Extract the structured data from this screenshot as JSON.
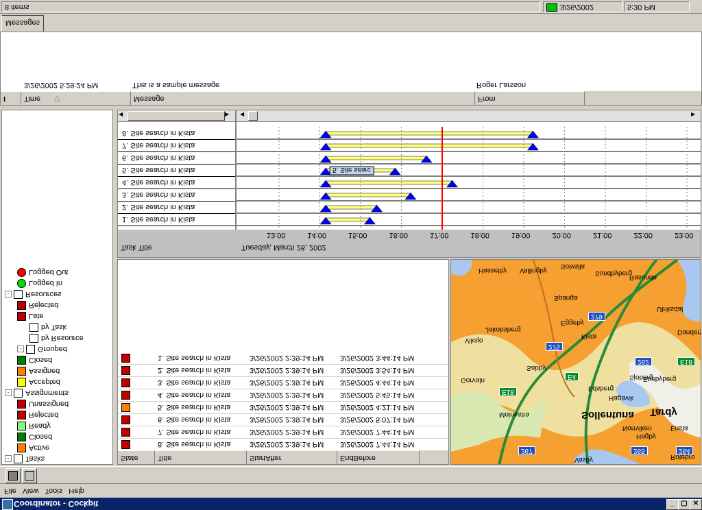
{
  "window": {
    "title": "Coordinator - Cockpit",
    "buttons": [
      "_",
      "▢",
      "✕"
    ]
  },
  "menu": [
    "File",
    "View",
    "Tools",
    "Help"
  ],
  "status": {
    "items_count": "8 items",
    "date": "3/26/2002",
    "time": "5:30 PM",
    "indicator_color": "#00c000"
  },
  "tabs": [
    "Messages"
  ],
  "messages": {
    "headers": [
      "Time",
      "Message",
      "From"
    ],
    "rows": [
      {
        "time": "3/26/2002 5:29:24 PM",
        "message": "This is a sample message",
        "from": "Roger Larsson"
      }
    ]
  },
  "tree": {
    "nodes": [
      {
        "label": "Tasks",
        "level": 0,
        "expand": "-",
        "icon": "tasks-icon",
        "color": "#ffffff"
      },
      {
        "label": "Active",
        "level": 1,
        "expand": "",
        "icon": "state-icon",
        "color": "#ff8000"
      },
      {
        "label": "Closed",
        "level": 1,
        "expand": "",
        "icon": "check-icon",
        "color": "#008000"
      },
      {
        "label": "Ready",
        "level": 1,
        "expand": "",
        "icon": "state-icon",
        "color": "#80ff80"
      },
      {
        "label": "Rejected",
        "level": 1,
        "expand": "",
        "icon": "reject-icon",
        "color": "#c00000"
      },
      {
        "label": "Unassigned",
        "level": 1,
        "expand": "",
        "icon": "state-icon",
        "color": "#c00000"
      },
      {
        "label": "Assignments",
        "level": 0,
        "expand": "-",
        "icon": "assignments-icon",
        "color": "#ffffff"
      },
      {
        "label": "Accepted",
        "level": 1,
        "expand": "",
        "icon": "state-icon",
        "color": "#ffff00"
      },
      {
        "label": "Assigned",
        "level": 1,
        "expand": "",
        "icon": "state-icon",
        "color": "#ff8000"
      },
      {
        "label": "Closed",
        "level": 1,
        "expand": "",
        "icon": "check-icon",
        "color": "#008000"
      },
      {
        "label": "Grouped",
        "level": 1,
        "expand": "-",
        "icon": "group-icon",
        "color": "#ffffff"
      },
      {
        "label": "by Resource",
        "level": 2,
        "expand": "",
        "icon": "resource-icon",
        "color": "#ffffff"
      },
      {
        "label": "by Task",
        "level": 2,
        "expand": "",
        "icon": "task-icon",
        "color": "#ffffff"
      },
      {
        "label": "Late",
        "level": 1,
        "expand": "",
        "icon": "late-icon",
        "color": "#c00000"
      },
      {
        "label": "Rejected",
        "level": 1,
        "expand": "",
        "icon": "reject-icon",
        "color": "#c00000"
      },
      {
        "label": "Resources",
        "level": 0,
        "expand": "-",
        "icon": "resources-icon",
        "color": "#ffffff"
      },
      {
        "label": "Logged In",
        "level": 1,
        "expand": "",
        "icon": "dot-icon",
        "color": "#00e000"
      },
      {
        "label": "Logged Out",
        "level": 1,
        "expand": "",
        "icon": "dot-icon",
        "color": "#ff0000"
      }
    ]
  },
  "tasks_table": {
    "headers": [
      "State",
      "Title",
      "StartAfter",
      "EndBefore"
    ],
    "rows": [
      {
        "state_color": "#c00000",
        "title": "8. Site search in Kista",
        "start": "3/26/2002 2:39:14 PM",
        "end": "3/26/2002 7:44:14 PM"
      },
      {
        "state_color": "#c00000",
        "title": "7. Site search in Kista",
        "start": "3/26/2002 2:39:14 PM",
        "end": "3/26/2002 7:44:14 PM"
      },
      {
        "state_color": "#c00000",
        "title": "6. Site search in Kista",
        "start": "3/26/2002 2:39:14 PM",
        "end": "3/26/2002 5:07:14 PM"
      },
      {
        "state_color": "#ff8000",
        "title": "5. Site search in Kista",
        "start": "3/26/2002 2:39:14 PM",
        "end": "3/26/2002 4:21:14 PM"
      },
      {
        "state_color": "#c00000",
        "title": "4. Site search in Kista",
        "start": "3/26/2002 2:39:14 PM",
        "end": "3/26/2002 5:45:14 PM"
      },
      {
        "state_color": "#c00000",
        "title": "3. Site search in Kista",
        "start": "3/26/2002 2:39:14 PM",
        "end": "3/26/2002 4:44:14 PM"
      },
      {
        "state_color": "#c00000",
        "title": "2. Site search in Kista",
        "start": "3/26/2002 2:39:14 PM",
        "end": "3/26/2002 3:54:14 PM"
      },
      {
        "state_color": "#c00000",
        "title": "1. Site search in Kista",
        "start": "3/26/2002 2:39:14 PM",
        "end": "3/26/2002 3:44:14 PM"
      }
    ]
  },
  "gantt": {
    "column_title": "Task Title",
    "date_label": "Tuesday, March 26, 2002",
    "ticks": [
      "13:00",
      "14:00",
      "15:00",
      "16:00",
      "17:00",
      "18:00",
      "19:00",
      "20:00",
      "21:00",
      "22:00",
      "23:00"
    ],
    "current_time": 17.0,
    "bar_color": "#ffff80",
    "marker_color": "#0000ff",
    "now_color": "#ff0000",
    "tasks": [
      {
        "title": "1. Site search in Kista",
        "start": 14.65,
        "end": 15.73
      },
      {
        "title": "2. Site search in Kista",
        "start": 14.65,
        "end": 15.9
      },
      {
        "title": "3. Site search in Kista",
        "start": 14.65,
        "end": 16.73
      },
      {
        "title": "4. Site search in Kista",
        "start": 14.65,
        "end": 17.75
      },
      {
        "title": "5. Site search in Kista",
        "start": 14.65,
        "end": 16.35,
        "label": "5. Site searc"
      },
      {
        "title": "6. Site search in Kista",
        "start": 14.65,
        "end": 17.12
      },
      {
        "title": "7. Site search in Kista",
        "start": 14.65,
        "end": 19.73
      },
      {
        "title": "8. Site search in Kista",
        "start": 14.65,
        "end": 19.73
      }
    ]
  },
  "map": {
    "labels": [
      "Hasselby",
      "Vallingby",
      "Solvalla",
      "Sundbyberg",
      "Rasunda",
      "Spanga",
      "Ulriksdal",
      "Eggeby",
      "Kista",
      "Jakobsberg",
      "Viksjo",
      "Danderyd",
      "Sabby",
      "Gorvaln",
      "Edsberg",
      "Sjoberg",
      "Enebyberg",
      "Hagavik",
      "Molnsatra",
      "Sollentuna",
      "Tardy",
      "Norrviken",
      "Ensta",
      "Hagby",
      "Rotebro",
      "Vasby"
    ],
    "roads": [
      "E18",
      "E4",
      "275",
      "279",
      "262",
      "267",
      "265",
      "264",
      "E18"
    ]
  }
}
